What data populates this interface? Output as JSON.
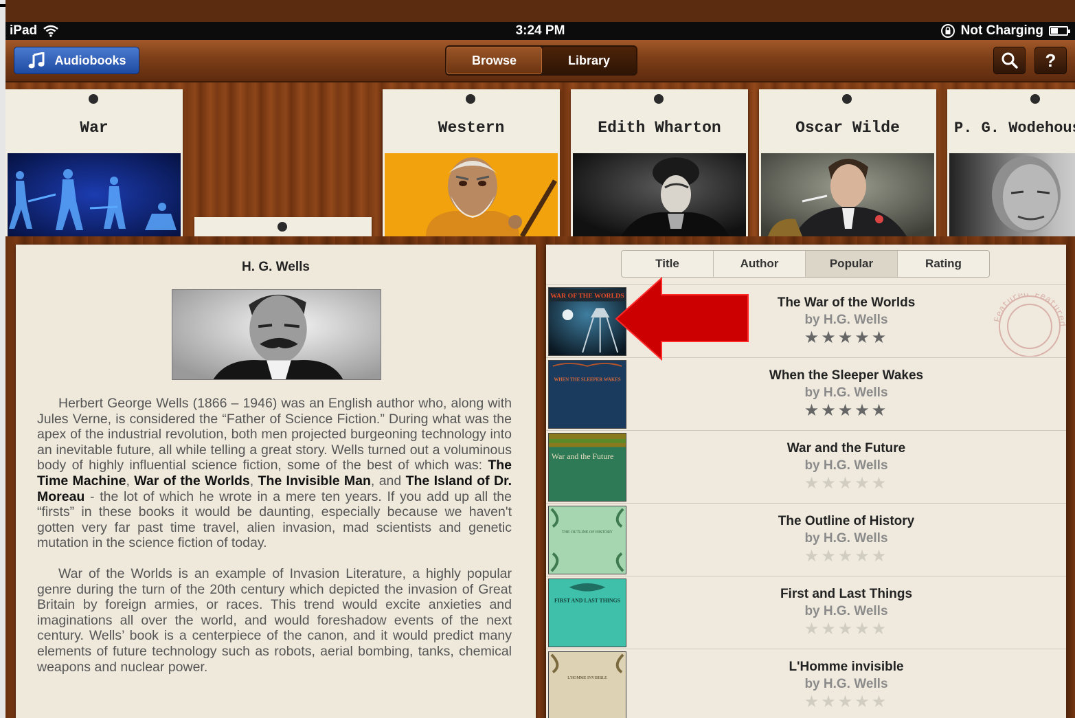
{
  "status_bar": {
    "device": "iPad",
    "time": "3:24 PM",
    "charging": "Not Charging"
  },
  "nav": {
    "audiobooks_label": "Audiobooks",
    "browse_label": "Browse",
    "library_label": "Library",
    "help_label": "?"
  },
  "shelf": {
    "cards": [
      {
        "label": "War"
      },
      {
        "label": "Western"
      },
      {
        "label": "Edith Wharton"
      },
      {
        "label": "Oscar Wilde"
      },
      {
        "label": "P. G. Wodehous"
      }
    ]
  },
  "detail": {
    "author": "H. G. Wells",
    "bio_p1_a": "Herbert George Wells (1866 – 1946) was an English author who, along with Jules Verne, is considered the “Father of Science Fiction.” During what was the apex of the industrial revolution, both men projected burgeoning technology into an inevitable future, all while telling a great story. Wells turned out a voluminous body of highly influential science fiction, some of the best of which was: ",
    "bio_p1_b1": "The Time Machine",
    "bio_p1_b2": "War of the Worlds",
    "bio_p1_b3": "The Invisible Man",
    "bio_p1_and": "and",
    "bio_p1_b4": "The Island of Dr. Moreau",
    "bio_p1_c": " - the lot of which he wrote in a mere ten years. If you add up all the “firsts” in these books it would be daunting, especially because we haven't gotten very far past time travel, alien invasion, mad scientists and genetic mutation in the science fiction of today.",
    "bio_p2": "War of the Worlds is an example of Invasion Literature, a highly popular genre during the turn of the 20th century which depicted the invasion of Great Britain by foreign armies, or races. This trend would excite anxieties and imaginations all over the world, and would foreshadow events of the next century. Wells’ book is a centerpiece of the canon, and it would predict many elements of future technology such as robots, aerial bombing, tanks, chemical weapons and nuclear power."
  },
  "sort_tabs": {
    "title": "Title",
    "author": "Author",
    "popular": "Popular",
    "rating": "Rating",
    "active": "Popular"
  },
  "books": [
    {
      "title": "The War of the Worlds",
      "author": "by H.G. Wells",
      "rating": 5,
      "stars": "★★★★★",
      "cover_text": "WAR OF THE WORLDS"
    },
    {
      "title": "When the Sleeper Wakes",
      "author": "by H.G. Wells",
      "rating": 5,
      "stars": "★★★★★",
      "cover_text": "WHEN THE SLEEPER WAKES"
    },
    {
      "title": "War and the Future",
      "author": "by H.G. Wells",
      "rating": 0,
      "stars": "★★★★★",
      "cover_text": "War and the Future"
    },
    {
      "title": "The Outline of History",
      "author": "by H.G. Wells",
      "rating": 0,
      "stars": "★★★★★",
      "cover_text": "THE OUTLINE OF HISTORY"
    },
    {
      "title": "First and Last Things",
      "author": "by H.G. Wells",
      "rating": 0,
      "stars": "★★★★★",
      "cover_text": "FIRST AND LAST THINGS"
    },
    {
      "title": "L'Homme invisible",
      "author": "by H.G. Wells",
      "rating": 0,
      "stars": "★★★★★",
      "cover_text": "L'HOMME INVISIBLE"
    }
  ],
  "stamp_text": "Featured Featured",
  "colors": {
    "nav_blue": "#1e4aa2",
    "annotation_arrow": "#cc0000",
    "wood": "#7a3a14",
    "paper": "#efe9dc"
  }
}
